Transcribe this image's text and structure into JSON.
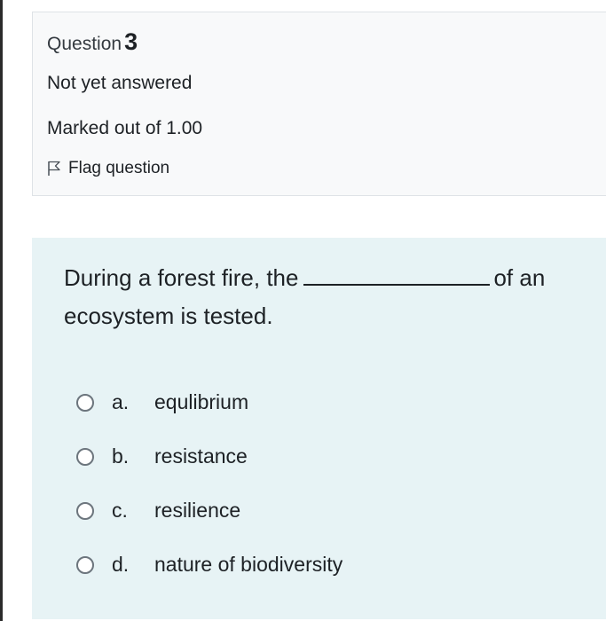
{
  "question": {
    "label": "Question",
    "number": "3",
    "state": "Not yet answered",
    "grade": "Marked out of 1.00",
    "flag_label": "Flag question",
    "flag_icon": "flag-icon"
  },
  "content": {
    "text_before": "During a forest fire, the",
    "text_after": "of an ecosystem is tested.",
    "options": [
      {
        "letter": "a.",
        "text": "equlibrium"
      },
      {
        "letter": "b.",
        "text": "resistance"
      },
      {
        "letter": "c.",
        "text": "resilience"
      },
      {
        "letter": "d.",
        "text": "nature of biodiversity"
      }
    ]
  },
  "colors": {
    "info_background": "#f8f9fa",
    "content_background": "#e7f3f5",
    "text": "#1d2125"
  }
}
